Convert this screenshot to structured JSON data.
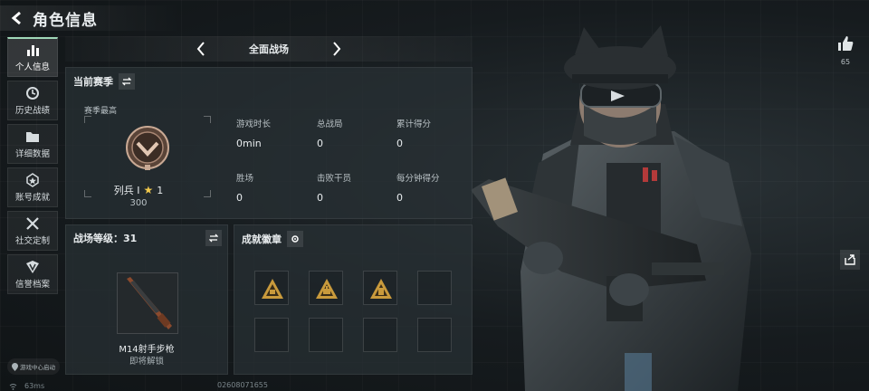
{
  "header": {
    "title": "角色信息"
  },
  "sidebar": {
    "items": [
      {
        "label": "个人信息",
        "icon": "bar-chart-icon",
        "active": true
      },
      {
        "label": "历史战绩",
        "icon": "history-clock-icon"
      },
      {
        "label": "详细数据",
        "icon": "folder-icon"
      },
      {
        "label": "账号成就",
        "icon": "achievement-star-icon"
      },
      {
        "label": "社交定制",
        "icon": "tools-icon"
      },
      {
        "label": "信誉档案",
        "icon": "shield-badge-icon"
      }
    ],
    "game_center": "游戏中心启动"
  },
  "mode": {
    "label": "全面战场"
  },
  "season": {
    "title": "当前赛季",
    "max_label": "赛季最高",
    "rank_name": "列兵 I",
    "rank_level": "1",
    "rank_points": "300",
    "stats": [
      {
        "key": "游戏时长",
        "value": "0min"
      },
      {
        "key": "总战局",
        "value": "0"
      },
      {
        "key": "累计得分",
        "value": "0"
      },
      {
        "key": "胜场",
        "value": "0"
      },
      {
        "key": "击败干员",
        "value": "0"
      },
      {
        "key": "每分钟得分",
        "value": "0"
      }
    ]
  },
  "battle_level": {
    "title": "战场等级：31",
    "weapon_name": "M14射手步枪",
    "weapon_status": "即将解锁"
  },
  "badges": {
    "title": "成就徽章"
  },
  "likes": {
    "count": "65"
  },
  "status": {
    "ping": "63ms",
    "uid": "02608071655"
  },
  "colors": {
    "accent": "#9fd8b8",
    "badge_gold": "#c99a3c",
    "star": "#f2c94c"
  }
}
